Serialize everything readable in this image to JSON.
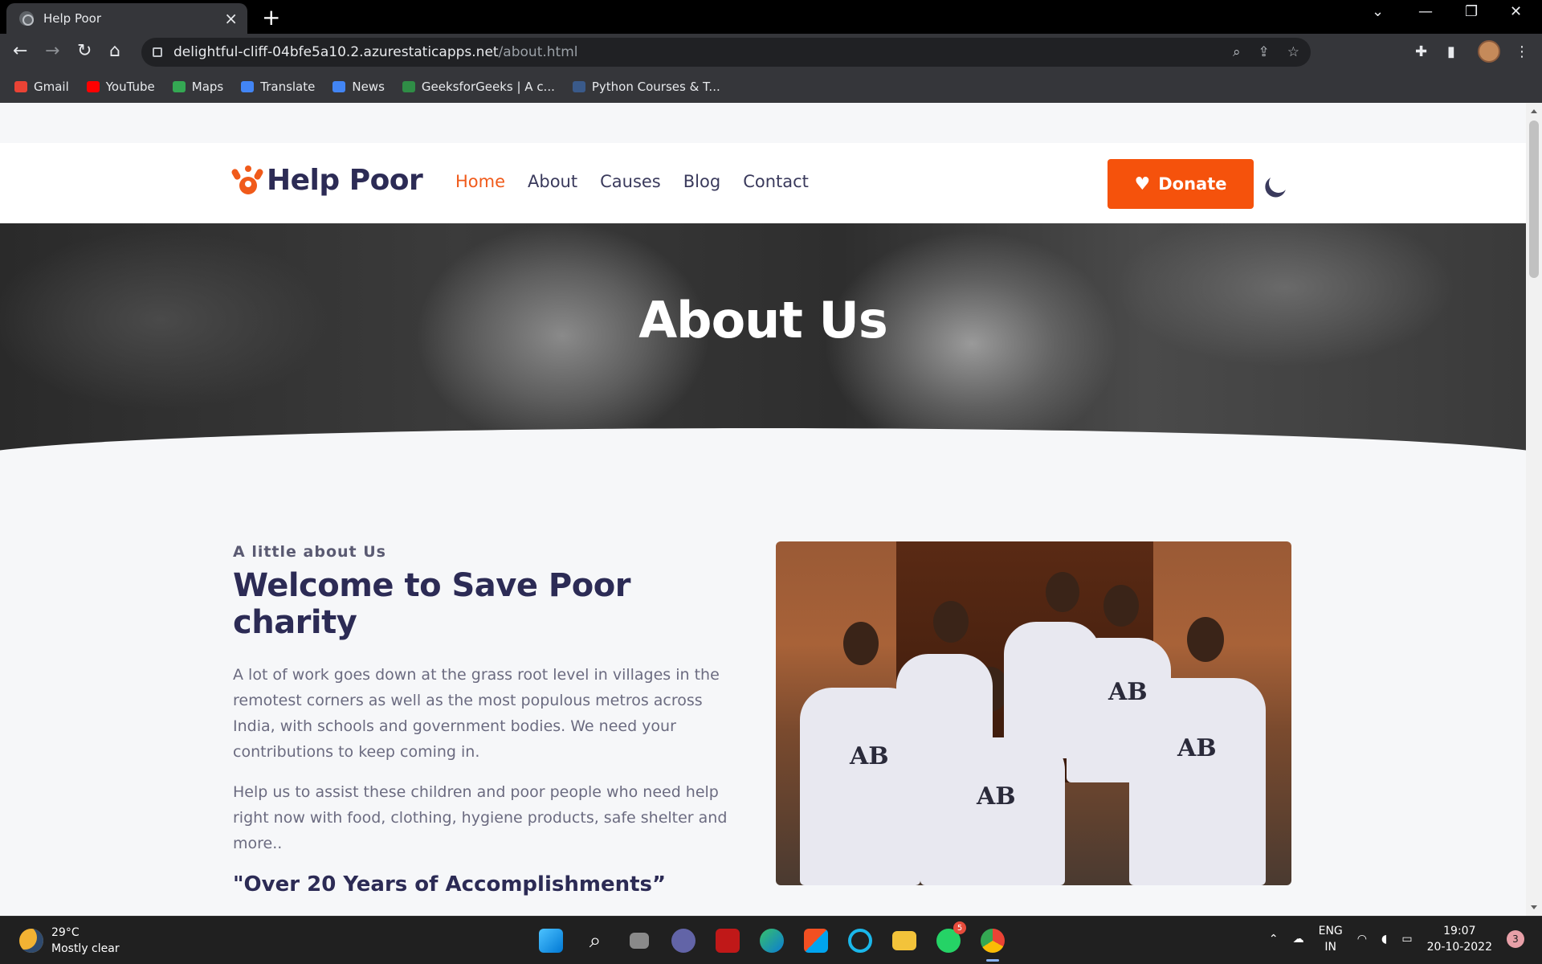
{
  "browser": {
    "tab_title": "Help Poor",
    "url_host": "delightful-cliff-04bfe5a10.2.azurestaticapps.net",
    "url_path": "/about.html",
    "bookmarks": [
      {
        "label": "Gmail",
        "color": "#ea4335"
      },
      {
        "label": "YouTube",
        "color": "#ff0000"
      },
      {
        "label": "Maps",
        "color": "#34a853"
      },
      {
        "label": "Translate",
        "color": "#4285f4"
      },
      {
        "label": "News",
        "color": "#4285f4"
      },
      {
        "label": "GeeksforGeeks | A c...",
        "color": "#2f8d46"
      },
      {
        "label": "Python Courses & T...",
        "color": "#3a5a8a"
      }
    ]
  },
  "site": {
    "logo_text": "Help Poor",
    "nav": [
      "Home",
      "About",
      "Causes",
      "Blog",
      "Contact"
    ],
    "active_nav": "Home",
    "donate_label": "Donate",
    "accent_color": "#f5520c",
    "hero_title": "About Us",
    "about": {
      "eyebrow": "A little about Us",
      "heading": "Welcome to Save Poor charity",
      "para1": "A lot of work goes down at the grass root level in villages in the remotest corners as well as the most populous metros across India, with schools and government bodies. We need your contributions to keep coming in.",
      "para2": "Help us to assist these children and poor people who need help right now with food, clothing, hygiene products, safe shelter and more..",
      "quote": "\"Over 20 Years of Accomplishments”"
    }
  },
  "taskbar": {
    "temp": "29°C",
    "condition": "Mostly clear",
    "lang_top": "ENG",
    "lang_bottom": "IN",
    "time": "19:07",
    "date": "20-10-2022",
    "notification_count": "3",
    "whatsapp_badge": "5"
  }
}
